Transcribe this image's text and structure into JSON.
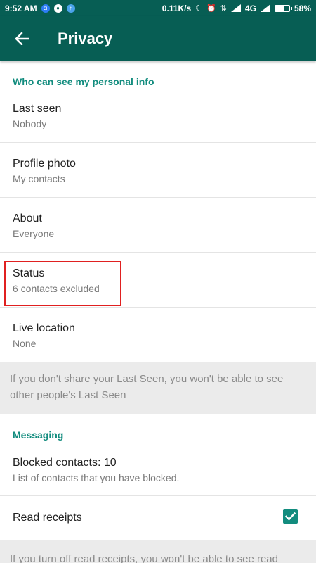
{
  "status_bar": {
    "time": "9:52 AM",
    "network_speed": "0.11K/s",
    "network_type": "4G",
    "battery": "58%",
    "battery_level": 0.58
  },
  "app_bar": {
    "title": "Privacy",
    "back_icon": "arrow-back-icon"
  },
  "personal_info": {
    "header": "Who can see my personal info",
    "items": [
      {
        "title": "Last seen",
        "subtitle": "Nobody"
      },
      {
        "title": "Profile photo",
        "subtitle": "My contacts"
      },
      {
        "title": "About",
        "subtitle": "Everyone"
      },
      {
        "title": "Status",
        "subtitle": "6 contacts excluded"
      },
      {
        "title": "Live location",
        "subtitle": "None"
      }
    ],
    "note": "If you don't share your Last Seen, you won't be able to see other people's Last Seen"
  },
  "messaging": {
    "header": "Messaging",
    "blocked": {
      "title": "Blocked contacts: 10",
      "subtitle": "List of contacts that you have blocked."
    },
    "read_receipts": {
      "title": "Read receipts",
      "checked": true
    },
    "note": "If you turn off read receipts, you won't be able to see read"
  },
  "colors": {
    "toolbar": "#075e54",
    "accent": "#128c7e",
    "highlight": "#e02020"
  }
}
